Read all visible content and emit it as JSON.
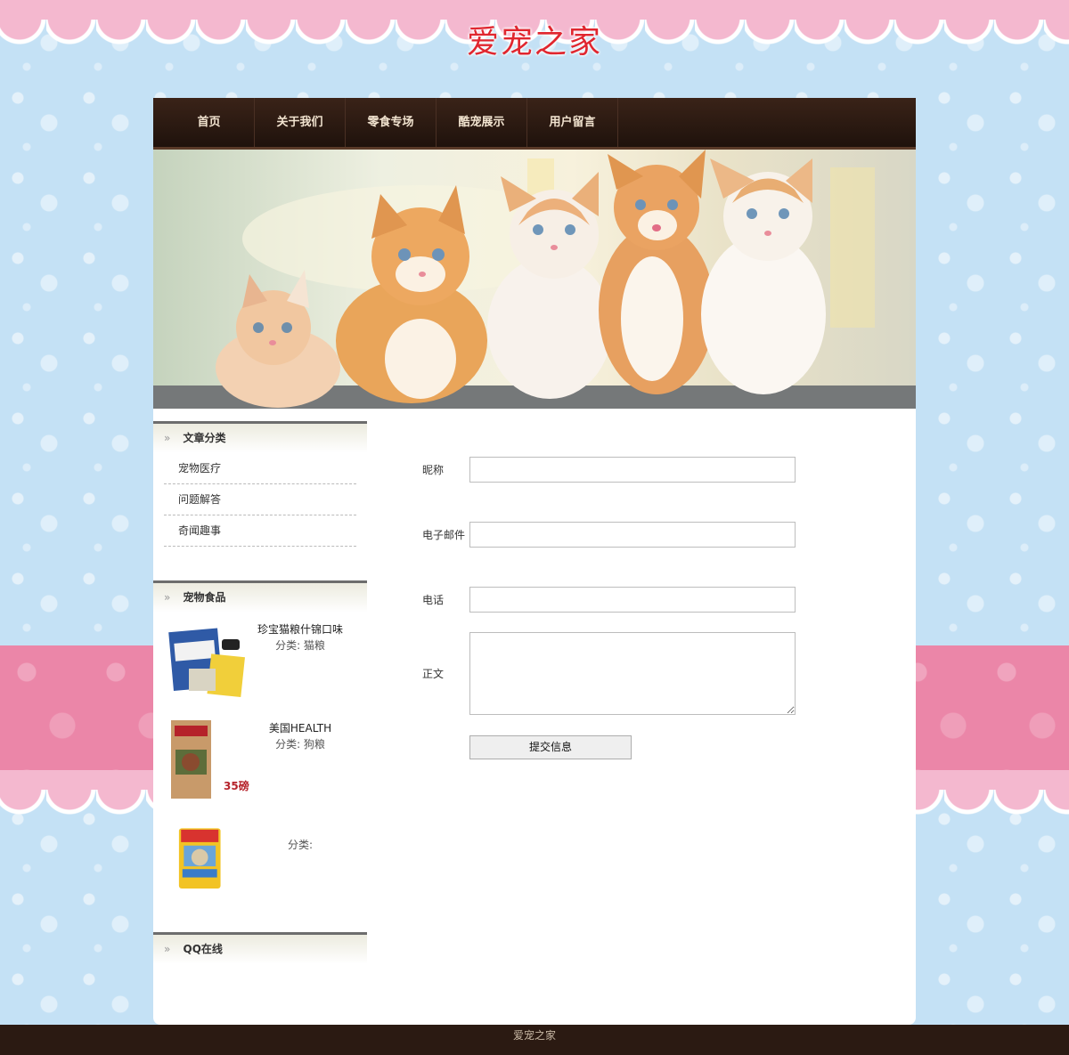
{
  "site": {
    "title": "爱宠之家"
  },
  "nav": [
    {
      "label": "首页"
    },
    {
      "label": "关于我们"
    },
    {
      "label": "零食专场"
    },
    {
      "label": "酷宠展示"
    },
    {
      "label": "用户留言"
    }
  ],
  "sidebar": {
    "categories_title": "文章分类",
    "categories": [
      {
        "label": "宠物医疗"
      },
      {
        "label": "问题解答"
      },
      {
        "label": "奇闻趣事"
      }
    ],
    "food_title": "宠物食品",
    "foods": [
      {
        "name": "珍宝猫粮什锦口味",
        "category": "分类: 猫粮"
      },
      {
        "name": "美国HEALTH",
        "category": "分类: 狗粮",
        "badge": "35磅"
      },
      {
        "name": "",
        "category": "分类:"
      }
    ],
    "qq_title": "QQ在线"
  },
  "form": {
    "nickname_label": "昵称",
    "email_label": "电子邮件",
    "phone_label": "电话",
    "body_label": "正文",
    "submit_label": "提交信息",
    "nickname_value": "",
    "email_value": "",
    "phone_value": "",
    "body_value": ""
  },
  "footer": {
    "text": "爱宠之家"
  },
  "colors": {
    "title_red": "#e0262f",
    "nav_brown": "#2b1a12",
    "bg_blue": "#c4e1f5",
    "awning_pink": "#f4b8cf"
  }
}
